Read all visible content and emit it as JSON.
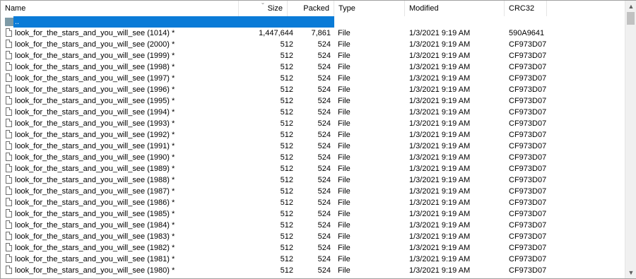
{
  "columns": {
    "name": "Name",
    "size": "Size",
    "packed": "Packed",
    "type": "Type",
    "modified": "Modified",
    "crc": "CRC32"
  },
  "sort_icon": "sort-descending-icon",
  "rows": [
    {
      "name": "..",
      "size": "",
      "packed": "",
      "type": "File folder",
      "modified": "",
      "crc": "",
      "icon": "folder-icon",
      "selected": true
    },
    {
      "name": "look_for_the_stars_and_you_will_see (1014) *",
      "size": "1,447,644",
      "packed": "7,861",
      "type": "File",
      "modified": "1/3/2021 9:19 AM",
      "crc": "590A9641",
      "icon": "file-icon"
    },
    {
      "name": "look_for_the_stars_and_you_will_see (2000) *",
      "size": "512",
      "packed": "524",
      "type": "File",
      "modified": "1/3/2021 9:19 AM",
      "crc": "CF973D07",
      "icon": "file-icon"
    },
    {
      "name": "look_for_the_stars_and_you_will_see (1999) *",
      "size": "512",
      "packed": "524",
      "type": "File",
      "modified": "1/3/2021 9:19 AM",
      "crc": "CF973D07",
      "icon": "file-icon"
    },
    {
      "name": "look_for_the_stars_and_you_will_see (1998) *",
      "size": "512",
      "packed": "524",
      "type": "File",
      "modified": "1/3/2021 9:19 AM",
      "crc": "CF973D07",
      "icon": "file-icon"
    },
    {
      "name": "look_for_the_stars_and_you_will_see (1997) *",
      "size": "512",
      "packed": "524",
      "type": "File",
      "modified": "1/3/2021 9:19 AM",
      "crc": "CF973D07",
      "icon": "file-icon"
    },
    {
      "name": "look_for_the_stars_and_you_will_see (1996) *",
      "size": "512",
      "packed": "524",
      "type": "File",
      "modified": "1/3/2021 9:19 AM",
      "crc": "CF973D07",
      "icon": "file-icon"
    },
    {
      "name": "look_for_the_stars_and_you_will_see (1995) *",
      "size": "512",
      "packed": "524",
      "type": "File",
      "modified": "1/3/2021 9:19 AM",
      "crc": "CF973D07",
      "icon": "file-icon"
    },
    {
      "name": "look_for_the_stars_and_you_will_see (1994) *",
      "size": "512",
      "packed": "524",
      "type": "File",
      "modified": "1/3/2021 9:19 AM",
      "crc": "CF973D07",
      "icon": "file-icon"
    },
    {
      "name": "look_for_the_stars_and_you_will_see (1993) *",
      "size": "512",
      "packed": "524",
      "type": "File",
      "modified": "1/3/2021 9:19 AM",
      "crc": "CF973D07",
      "icon": "file-icon"
    },
    {
      "name": "look_for_the_stars_and_you_will_see (1992) *",
      "size": "512",
      "packed": "524",
      "type": "File",
      "modified": "1/3/2021 9:19 AM",
      "crc": "CF973D07",
      "icon": "file-icon"
    },
    {
      "name": "look_for_the_stars_and_you_will_see (1991) *",
      "size": "512",
      "packed": "524",
      "type": "File",
      "modified": "1/3/2021 9:19 AM",
      "crc": "CF973D07",
      "icon": "file-icon"
    },
    {
      "name": "look_for_the_stars_and_you_will_see (1990) *",
      "size": "512",
      "packed": "524",
      "type": "File",
      "modified": "1/3/2021 9:19 AM",
      "crc": "CF973D07",
      "icon": "file-icon"
    },
    {
      "name": "look_for_the_stars_and_you_will_see (1989) *",
      "size": "512",
      "packed": "524",
      "type": "File",
      "modified": "1/3/2021 9:19 AM",
      "crc": "CF973D07",
      "icon": "file-icon"
    },
    {
      "name": "look_for_the_stars_and_you_will_see (1988) *",
      "size": "512",
      "packed": "524",
      "type": "File",
      "modified": "1/3/2021 9:19 AM",
      "crc": "CF973D07",
      "icon": "file-icon"
    },
    {
      "name": "look_for_the_stars_and_you_will_see (1987) *",
      "size": "512",
      "packed": "524",
      "type": "File",
      "modified": "1/3/2021 9:19 AM",
      "crc": "CF973D07",
      "icon": "file-icon"
    },
    {
      "name": "look_for_the_stars_and_you_will_see (1986) *",
      "size": "512",
      "packed": "524",
      "type": "File",
      "modified": "1/3/2021 9:19 AM",
      "crc": "CF973D07",
      "icon": "file-icon"
    },
    {
      "name": "look_for_the_stars_and_you_will_see (1985) *",
      "size": "512",
      "packed": "524",
      "type": "File",
      "modified": "1/3/2021 9:19 AM",
      "crc": "CF973D07",
      "icon": "file-icon"
    },
    {
      "name": "look_for_the_stars_and_you_will_see (1984) *",
      "size": "512",
      "packed": "524",
      "type": "File",
      "modified": "1/3/2021 9:19 AM",
      "crc": "CF973D07",
      "icon": "file-icon"
    },
    {
      "name": "look_for_the_stars_and_you_will_see (1983) *",
      "size": "512",
      "packed": "524",
      "type": "File",
      "modified": "1/3/2021 9:19 AM",
      "crc": "CF973D07",
      "icon": "file-icon"
    },
    {
      "name": "look_for_the_stars_and_you_will_see (1982) *",
      "size": "512",
      "packed": "524",
      "type": "File",
      "modified": "1/3/2021 9:19 AM",
      "crc": "CF973D07",
      "icon": "file-icon"
    },
    {
      "name": "look_for_the_stars_and_you_will_see (1981) *",
      "size": "512",
      "packed": "524",
      "type": "File",
      "modified": "1/3/2021 9:19 AM",
      "crc": "CF973D07",
      "icon": "file-icon"
    },
    {
      "name": "look_for_the_stars_and_you_will_see (1980) *",
      "size": "512",
      "packed": "524",
      "type": "File",
      "modified": "1/3/2021 9:19 AM",
      "crc": "CF973D07",
      "icon": "file-icon"
    }
  ],
  "scrollbar": {
    "up_icon": "scroll-up-icon",
    "down_icon": "scroll-down-icon"
  },
  "colors": {
    "selection": "#0a7bd7",
    "folder_icon": "#7d9aa6"
  }
}
